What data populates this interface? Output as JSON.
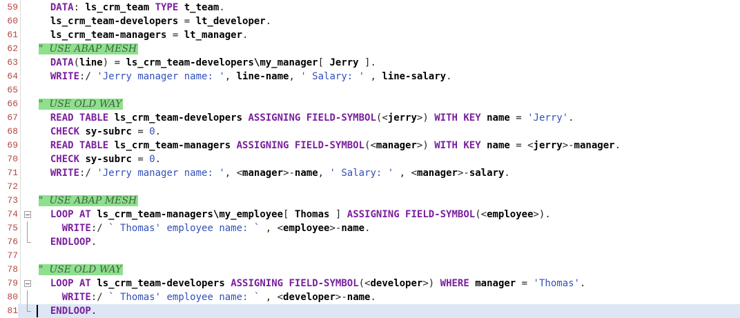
{
  "editor": {
    "current_line": 81,
    "lines": [
      {
        "num": "59",
        "indent": "  ",
        "tokens": [
          {
            "t": "kw",
            "v": "DATA"
          },
          {
            "t": "op",
            "v": ": "
          },
          {
            "t": "id",
            "v": "ls_crm_team"
          },
          {
            "t": "op",
            "v": " "
          },
          {
            "t": "kw",
            "v": "TYPE"
          },
          {
            "t": "op",
            "v": " "
          },
          {
            "t": "id",
            "v": "t_team"
          },
          {
            "t": "op",
            "v": "."
          }
        ]
      },
      {
        "num": "60",
        "indent": "  ",
        "tokens": [
          {
            "t": "id",
            "v": "ls_crm_team-developers"
          },
          {
            "t": "op",
            "v": " = "
          },
          {
            "t": "id",
            "v": "lt_developer"
          },
          {
            "t": "op",
            "v": "."
          }
        ]
      },
      {
        "num": "61",
        "indent": "  ",
        "tokens": [
          {
            "t": "id",
            "v": "ls_crm_team-managers"
          },
          {
            "t": "op",
            "v": " = "
          },
          {
            "t": "id",
            "v": "lt_manager"
          },
          {
            "t": "op",
            "v": "."
          }
        ]
      },
      {
        "num": "62",
        "indent": "",
        "comment": "\"  USE ABAP MESH"
      },
      {
        "num": "63",
        "indent": "  ",
        "tokens": [
          {
            "t": "kw",
            "v": "DATA"
          },
          {
            "t": "op",
            "v": "("
          },
          {
            "t": "id",
            "v": "line"
          },
          {
            "t": "op",
            "v": ") = "
          },
          {
            "t": "id",
            "v": "ls_crm_team-developers\\my_manager"
          },
          {
            "t": "op",
            "v": "[ "
          },
          {
            "t": "id",
            "v": "Jerry"
          },
          {
            "t": "op",
            "v": " ]."
          }
        ]
      },
      {
        "num": "64",
        "indent": "  ",
        "tokens": [
          {
            "t": "kw",
            "v": "WRITE"
          },
          {
            "t": "op",
            "v": ":/ "
          },
          {
            "t": "str",
            "v": "'Jerry manager name: '"
          },
          {
            "t": "op",
            "v": ", "
          },
          {
            "t": "id",
            "v": "line-name"
          },
          {
            "t": "op",
            "v": ", "
          },
          {
            "t": "str",
            "v": "' Salary: '"
          },
          {
            "t": "op",
            "v": " , "
          },
          {
            "t": "id",
            "v": "line-salary"
          },
          {
            "t": "op",
            "v": "."
          }
        ]
      },
      {
        "num": "65",
        "indent": "",
        "tokens": []
      },
      {
        "num": "66",
        "indent": "",
        "comment": "\"  USE OLD WAY"
      },
      {
        "num": "67",
        "indent": "  ",
        "tokens": [
          {
            "t": "kw",
            "v": "READ TABLE"
          },
          {
            "t": "op",
            "v": " "
          },
          {
            "t": "id",
            "v": "ls_crm_team-developers"
          },
          {
            "t": "op",
            "v": " "
          },
          {
            "t": "kw",
            "v": "ASSIGNING FIELD-SYMBOL"
          },
          {
            "t": "op",
            "v": "(<"
          },
          {
            "t": "id",
            "v": "jerry"
          },
          {
            "t": "op",
            "v": ">) "
          },
          {
            "t": "kw",
            "v": "WITH KEY"
          },
          {
            "t": "op",
            "v": " "
          },
          {
            "t": "id",
            "v": "name"
          },
          {
            "t": "op",
            "v": " = "
          },
          {
            "t": "str",
            "v": "'Jerry'"
          },
          {
            "t": "op",
            "v": "."
          }
        ]
      },
      {
        "num": "68",
        "indent": "  ",
        "tokens": [
          {
            "t": "kw",
            "v": "CHECK"
          },
          {
            "t": "op",
            "v": " "
          },
          {
            "t": "id",
            "v": "sy-subrc"
          },
          {
            "t": "op",
            "v": " = "
          },
          {
            "t": "num",
            "v": "0"
          },
          {
            "t": "op",
            "v": "."
          }
        ]
      },
      {
        "num": "69",
        "indent": "  ",
        "tokens": [
          {
            "t": "kw",
            "v": "READ TABLE"
          },
          {
            "t": "op",
            "v": " "
          },
          {
            "t": "id",
            "v": "ls_crm_team-managers"
          },
          {
            "t": "op",
            "v": " "
          },
          {
            "t": "kw",
            "v": "ASSIGNING FIELD-SYMBOL"
          },
          {
            "t": "op",
            "v": "(<"
          },
          {
            "t": "id",
            "v": "manager"
          },
          {
            "t": "op",
            "v": ">) "
          },
          {
            "t": "kw",
            "v": "WITH KEY"
          },
          {
            "t": "op",
            "v": " "
          },
          {
            "t": "id",
            "v": "name"
          },
          {
            "t": "op",
            "v": " = <"
          },
          {
            "t": "id",
            "v": "jerry"
          },
          {
            "t": "op",
            "v": ">-"
          },
          {
            "t": "id",
            "v": "manager"
          },
          {
            "t": "op",
            "v": "."
          }
        ]
      },
      {
        "num": "70",
        "indent": "  ",
        "tokens": [
          {
            "t": "kw",
            "v": "CHECK"
          },
          {
            "t": "op",
            "v": " "
          },
          {
            "t": "id",
            "v": "sy-subrc"
          },
          {
            "t": "op",
            "v": " = "
          },
          {
            "t": "num",
            "v": "0"
          },
          {
            "t": "op",
            "v": "."
          }
        ]
      },
      {
        "num": "71",
        "indent": "  ",
        "tokens": [
          {
            "t": "kw",
            "v": "WRITE"
          },
          {
            "t": "op",
            "v": ":/ "
          },
          {
            "t": "str",
            "v": "'Jerry manager name: '"
          },
          {
            "t": "op",
            "v": ", <"
          },
          {
            "t": "id",
            "v": "manager"
          },
          {
            "t": "op",
            "v": ">-"
          },
          {
            "t": "id",
            "v": "name"
          },
          {
            "t": "op",
            "v": ", "
          },
          {
            "t": "str",
            "v": "' Salary: '"
          },
          {
            "t": "op",
            "v": " , <"
          },
          {
            "t": "id",
            "v": "manager"
          },
          {
            "t": "op",
            "v": ">-"
          },
          {
            "t": "id",
            "v": "salary"
          },
          {
            "t": "op",
            "v": "."
          }
        ]
      },
      {
        "num": "72",
        "indent": "",
        "tokens": []
      },
      {
        "num": "73",
        "indent": "",
        "comment": "\"  USE ABAP MESH"
      },
      {
        "num": "74",
        "indent": "  ",
        "fold": "open",
        "tokens": [
          {
            "t": "kw",
            "v": "LOOP AT"
          },
          {
            "t": "op",
            "v": " "
          },
          {
            "t": "id",
            "v": "ls_crm_team-managers\\my_employee"
          },
          {
            "t": "op",
            "v": "[ "
          },
          {
            "t": "id",
            "v": "Thomas"
          },
          {
            "t": "op",
            "v": " ] "
          },
          {
            "t": "kw",
            "v": "ASSIGNING FIELD-SYMBOL"
          },
          {
            "t": "op",
            "v": "(<"
          },
          {
            "t": "id",
            "v": "employee"
          },
          {
            "t": "op",
            "v": ">)."
          }
        ]
      },
      {
        "num": "75",
        "indent": "    ",
        "fold": "line",
        "tokens": [
          {
            "t": "kw",
            "v": "WRITE"
          },
          {
            "t": "op",
            "v": ":/ "
          },
          {
            "t": "str",
            "v": "` Thomas' employee name: `"
          },
          {
            "t": "op",
            "v": " , <"
          },
          {
            "t": "id",
            "v": "employee"
          },
          {
            "t": "op",
            "v": ">-"
          },
          {
            "t": "id",
            "v": "name"
          },
          {
            "t": "op",
            "v": "."
          }
        ]
      },
      {
        "num": "76",
        "indent": "  ",
        "fold": "end",
        "tokens": [
          {
            "t": "kw",
            "v": "ENDLOOP"
          },
          {
            "t": "op",
            "v": "."
          }
        ]
      },
      {
        "num": "77",
        "indent": "",
        "tokens": []
      },
      {
        "num": "78",
        "indent": "",
        "comment": "\"  USE OLD WAY"
      },
      {
        "num": "79",
        "indent": "  ",
        "fold": "open",
        "tokens": [
          {
            "t": "kw",
            "v": "LOOP AT"
          },
          {
            "t": "op",
            "v": " "
          },
          {
            "t": "id",
            "v": "ls_crm_team-developers"
          },
          {
            "t": "op",
            "v": " "
          },
          {
            "t": "kw",
            "v": "ASSIGNING FIELD-SYMBOL"
          },
          {
            "t": "op",
            "v": "(<"
          },
          {
            "t": "id",
            "v": "developer"
          },
          {
            "t": "op",
            "v": ">) "
          },
          {
            "t": "kw",
            "v": "WHERE"
          },
          {
            "t": "op",
            "v": " "
          },
          {
            "t": "id",
            "v": "manager"
          },
          {
            "t": "op",
            "v": " = "
          },
          {
            "t": "str",
            "v": "'Thomas'"
          },
          {
            "t": "op",
            "v": "."
          }
        ]
      },
      {
        "num": "80",
        "indent": "    ",
        "fold": "line",
        "tokens": [
          {
            "t": "kw",
            "v": "WRITE"
          },
          {
            "t": "op",
            "v": ":/ "
          },
          {
            "t": "str",
            "v": "` Thomas' employee name: `"
          },
          {
            "t": "op",
            "v": " , <"
          },
          {
            "t": "id",
            "v": "developer"
          },
          {
            "t": "op",
            "v": ">-"
          },
          {
            "t": "id",
            "v": "name"
          },
          {
            "t": "op",
            "v": "."
          }
        ]
      },
      {
        "num": "81",
        "indent": "  ",
        "fold": "end",
        "current": true,
        "tokens": [
          {
            "t": "kw",
            "v": "ENDLOOP"
          },
          {
            "t": "op",
            "v": "."
          }
        ]
      }
    ]
  },
  "colors": {
    "keyword": "#7a1f9e",
    "string": "#3050b8",
    "line_number": "#b4443c",
    "comment_highlight": "#8ee08e",
    "current_line": "#dce6f4"
  }
}
